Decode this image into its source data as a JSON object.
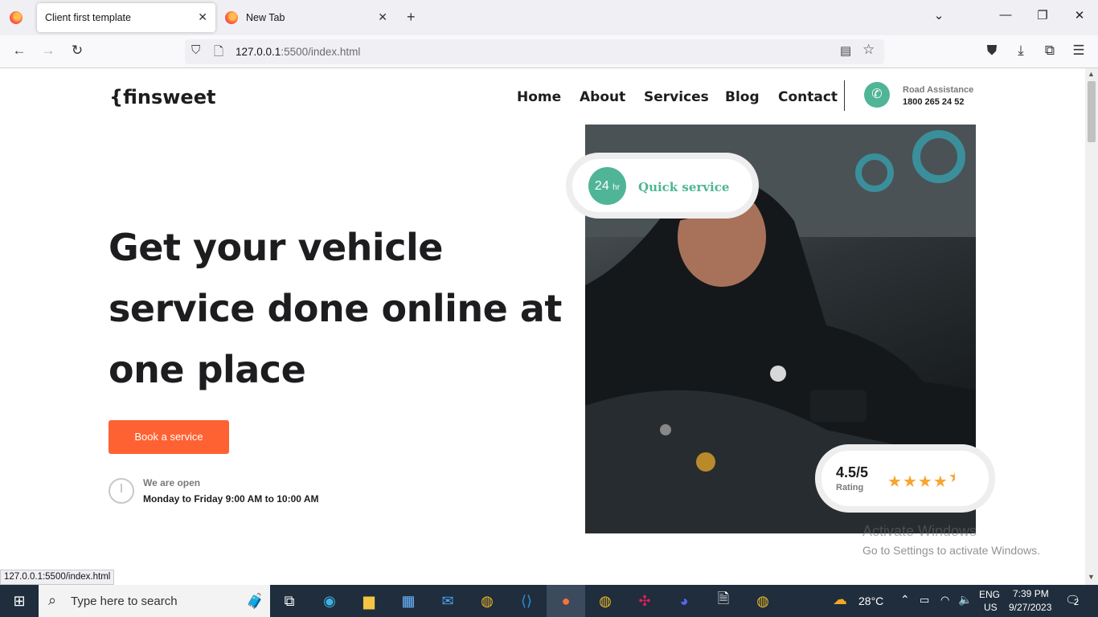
{
  "browser": {
    "tabs": [
      {
        "title": "Client first template",
        "active": true
      },
      {
        "title": "New Tab",
        "active": false
      }
    ],
    "url_host": "127.0.0.1",
    "url_rest": ":5500/index.html",
    "status_link": "127.0.0.1:5500/index.html"
  },
  "site": {
    "logo": "{finsweet",
    "nav": [
      "Home",
      "About",
      "Services",
      "Blog",
      "Contact"
    ],
    "assistance_title": "Road Assistance",
    "assistance_phone": "1800 265 24 52",
    "hero_lines": [
      "Get your vehicle",
      "service done online at",
      "one place"
    ],
    "cta": "Book a service",
    "open_title": "We are open",
    "open_hours": "Monday to Friday 9:00 AM to 10:00 AM",
    "quick_badge_number": "24",
    "quick_badge_unit": "hr",
    "quick_text": "Quick service",
    "rating_value": "4.5/5",
    "rating_label": "Rating",
    "rating_stars": 4.5
  },
  "watermark": {
    "line1": "Activate Windows",
    "line2": "Go to Settings to activate Windows."
  },
  "taskbar": {
    "search_placeholder": "Type here to search",
    "weather": "28°C",
    "lang1": "ENG",
    "lang2": "US",
    "time": "7:39 PM",
    "date": "9/27/2023",
    "notifications": "2"
  },
  "colors": {
    "accent_green": "#4fb596",
    "cta_orange": "#fe6232",
    "star": "#f7a531"
  }
}
